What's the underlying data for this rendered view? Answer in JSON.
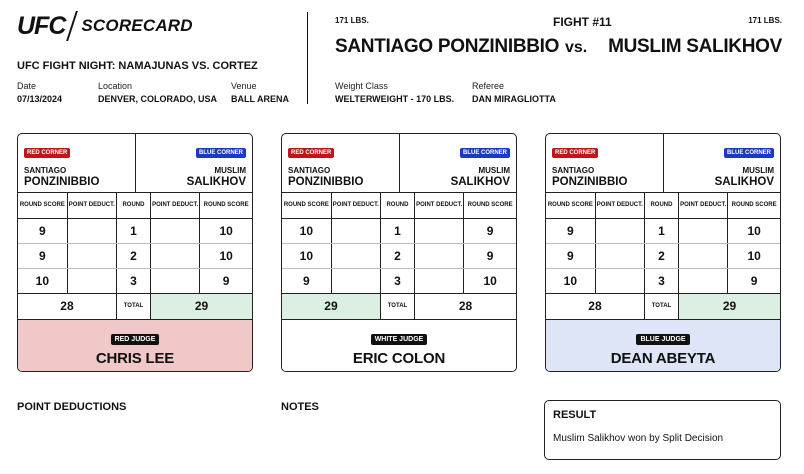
{
  "header": {
    "logo": "UFC",
    "doc_title": "SCORECARD",
    "event": "UFC FIGHT NIGHT: NAMAJUNAS VS. CORTEZ",
    "date_label": "Date",
    "date": "07/13/2024",
    "location_label": "Location",
    "location": "DENVER, COLORADO, USA",
    "venue_label": "Venue",
    "venue": "BALL ARENA"
  },
  "bout": {
    "fight_number": "FIGHT #11",
    "red_weight": "171 LBS.",
    "blue_weight": "171 LBS.",
    "red_fighter": "SANTIAGO PONZINIBBIO",
    "vs": "vs.",
    "blue_fighter": "MUSLIM SALIKHOV",
    "weight_class_label": "Weight Class",
    "weight_class": "WELTERWEIGHT - 170 LBS.",
    "referee_label": "Referee",
    "referee": "DAN MIRAGLIOTTA"
  },
  "labels": {
    "red_corner": "RED CORNER",
    "blue_corner": "BLUE CORNER",
    "round_score": "ROUND SCORE",
    "point_deduct": "POINT DEDUCT.",
    "round": "ROUND",
    "total": "TOTAL",
    "red_first": "SANTIAGO",
    "red_last": "PONZINIBBIO",
    "blue_first": "MUSLIM",
    "blue_last": "SALIKHOV"
  },
  "cards": [
    {
      "judge_badge": "RED JUDGE",
      "judge_name": "CHRIS LEE",
      "judge_color": "red",
      "rounds": [
        {
          "round": "1",
          "red": "9",
          "blue": "10",
          "red_ded": "",
          "blue_ded": ""
        },
        {
          "round": "2",
          "red": "9",
          "blue": "10",
          "red_ded": "",
          "blue_ded": ""
        },
        {
          "round": "3",
          "red": "10",
          "blue": "9",
          "red_ded": "",
          "blue_ded": ""
        }
      ],
      "red_total": "28",
      "blue_total": "29",
      "winner": "blue"
    },
    {
      "judge_badge": "WHITE JUDGE",
      "judge_name": "ERIC COLON",
      "judge_color": "white",
      "rounds": [
        {
          "round": "1",
          "red": "10",
          "blue": "9",
          "red_ded": "",
          "blue_ded": ""
        },
        {
          "round": "2",
          "red": "10",
          "blue": "9",
          "red_ded": "",
          "blue_ded": ""
        },
        {
          "round": "3",
          "red": "9",
          "blue": "10",
          "red_ded": "",
          "blue_ded": ""
        }
      ],
      "red_total": "29",
      "blue_total": "28",
      "winner": "red"
    },
    {
      "judge_badge": "BLUE JUDGE",
      "judge_name": "DEAN ABEYTA",
      "judge_color": "blue",
      "rounds": [
        {
          "round": "1",
          "red": "9",
          "blue": "10",
          "red_ded": "",
          "blue_ded": ""
        },
        {
          "round": "2",
          "red": "9",
          "blue": "10",
          "red_ded": "",
          "blue_ded": ""
        },
        {
          "round": "3",
          "red": "10",
          "blue": "9",
          "red_ded": "",
          "blue_ded": ""
        }
      ],
      "red_total": "28",
      "blue_total": "29",
      "winner": "blue"
    }
  ],
  "sections": {
    "point_deductions": "POINT DEDUCTIONS",
    "notes": "NOTES",
    "result_title": "RESULT",
    "result_text": "Muslim Salikhov won by Split Decision"
  },
  "colors": {
    "red_corner": "#c0151b",
    "blue_corner": "#1b3bbf",
    "winner_highlight": "#dcefe3",
    "red_judge_bg": "#f1c8c8",
    "blue_judge_bg": "#dde5f6"
  }
}
